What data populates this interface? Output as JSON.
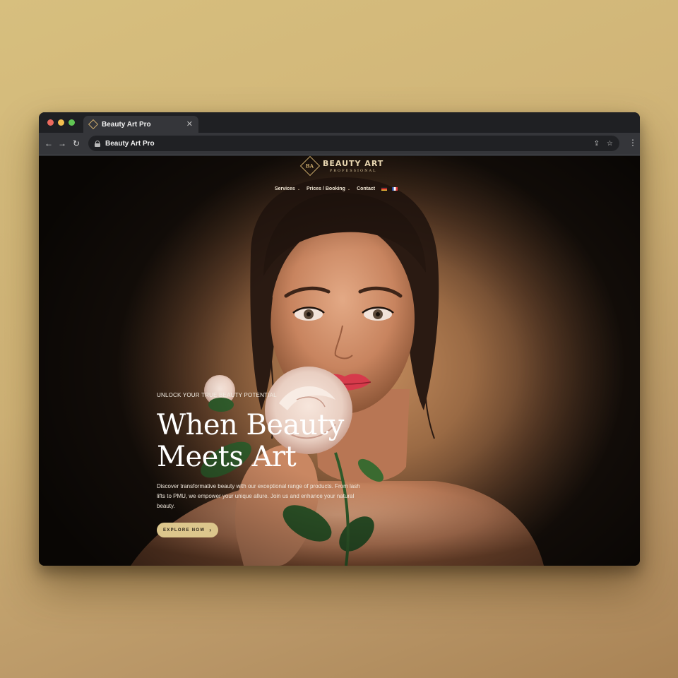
{
  "browser": {
    "tab_title": "Beauty Art Pro",
    "tab_close": "✕",
    "url": "Beauty Art Pro",
    "back": "←",
    "forward": "→",
    "reload": "↻",
    "share": "⇪",
    "bookmark": "☆",
    "menu": "⋮"
  },
  "site": {
    "logo": {
      "name": "BEAUTY ART",
      "subtitle": "PROFESSIONAL",
      "mark": "BA"
    },
    "nav": [
      {
        "label": "Services",
        "has_dropdown": true
      },
      {
        "label": "Prices / Booking",
        "has_dropdown": true
      },
      {
        "label": "Contact",
        "has_dropdown": false
      }
    ],
    "nav_chevron": "⌄",
    "languages": [
      "de-flag-icon",
      "fr-flag-icon"
    ],
    "hero": {
      "eyebrow": "UNLOCK YOUR TRUE BEAUTY POTENTIAL",
      "headline": "When Beauty\nMeets Art",
      "description": "Discover transformative beauty with our exceptional range of products. From lash lifts to PMU, we empower your unique allure. Join us and enhance your natural beauty.",
      "cta": "EXPLORE NOW",
      "cta_arrow": "›"
    }
  },
  "colors": {
    "accent_gold": "#dcc68c",
    "logo_gold": "#c9a86a",
    "background": "#d7bf7e"
  }
}
